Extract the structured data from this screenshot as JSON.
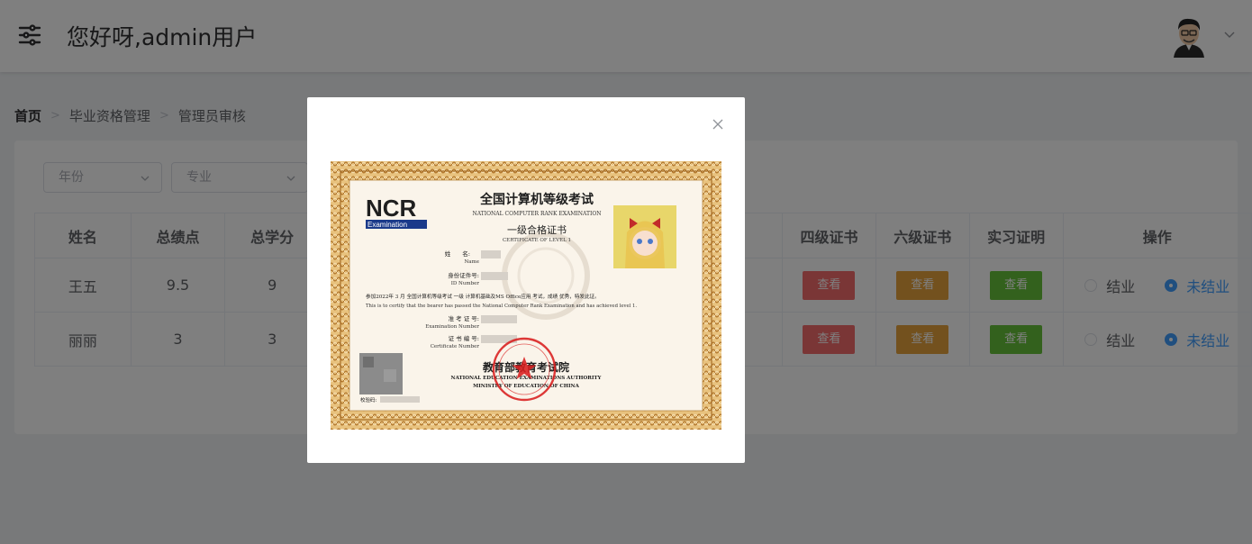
{
  "header": {
    "greeting": "您好呀,admin用户"
  },
  "breadcrumb": {
    "home": "首页",
    "items": [
      "毕业资格管理",
      "管理员审核"
    ],
    "separator": ">"
  },
  "filters": {
    "year_placeholder": "年份",
    "major_placeholder": "专业"
  },
  "table": {
    "columns": [
      "姓名",
      "总绩点",
      "总学分",
      "四级证书",
      "六级证书",
      "实习证明",
      "操作"
    ],
    "rows": [
      {
        "name": "王五",
        "gpa": "9.5",
        "credits": "9",
        "btn4": "查看",
        "btn6": "查看",
        "btn_intern": "查看",
        "opt1": "结业",
        "opt2": "未结业"
      },
      {
        "name": "丽丽",
        "gpa": "3",
        "credits": "3",
        "btn4": "查看",
        "btn6": "查看",
        "btn_intern": "查看",
        "opt1": "结业",
        "opt2": "未结业"
      }
    ]
  },
  "certificate": {
    "logo": "NCR",
    "logo_sub": "Examination",
    "title_cn": "全国计算机等级考试",
    "title_en": "NATIONAL COMPUTER RANK EXAMINATION",
    "level_cn": "一级合格证书",
    "level_en": "CERTIFICATE OF LEVEL 1",
    "name_label_cn": "姓　　名:",
    "name_label_en": "Name",
    "id_label_cn": "身份证件号:",
    "id_label_en": "ID Number",
    "body_cn": "参加2022年 3 月 全国计算机等级考试 一级 计算机基础及MS Office应用 考试，成绩 优秀，特发此证。",
    "body_en": "This is to certify that the bearer has passed the National Computer Rank Examination and has achieved level 1.",
    "exam_no_cn": "准 考 证 号:",
    "exam_no_en": "Examination Number",
    "cert_no_cn": "证 书 编 号:",
    "cert_no_en": "Certificate Number",
    "authority_cn": "教育部教育考试院",
    "authority_en1": "NATIONAL EDUCATION EXAMINATIONS AUTHORITY",
    "authority_en2": "MINISTRY OF EDUCATION OF CHINA",
    "check_label": "校验码:"
  },
  "colors": {
    "danger": "#f56c6c",
    "warning": "#e6a23c",
    "success": "#67c23a",
    "primary": "#409eff",
    "frame": "#c8923f"
  }
}
